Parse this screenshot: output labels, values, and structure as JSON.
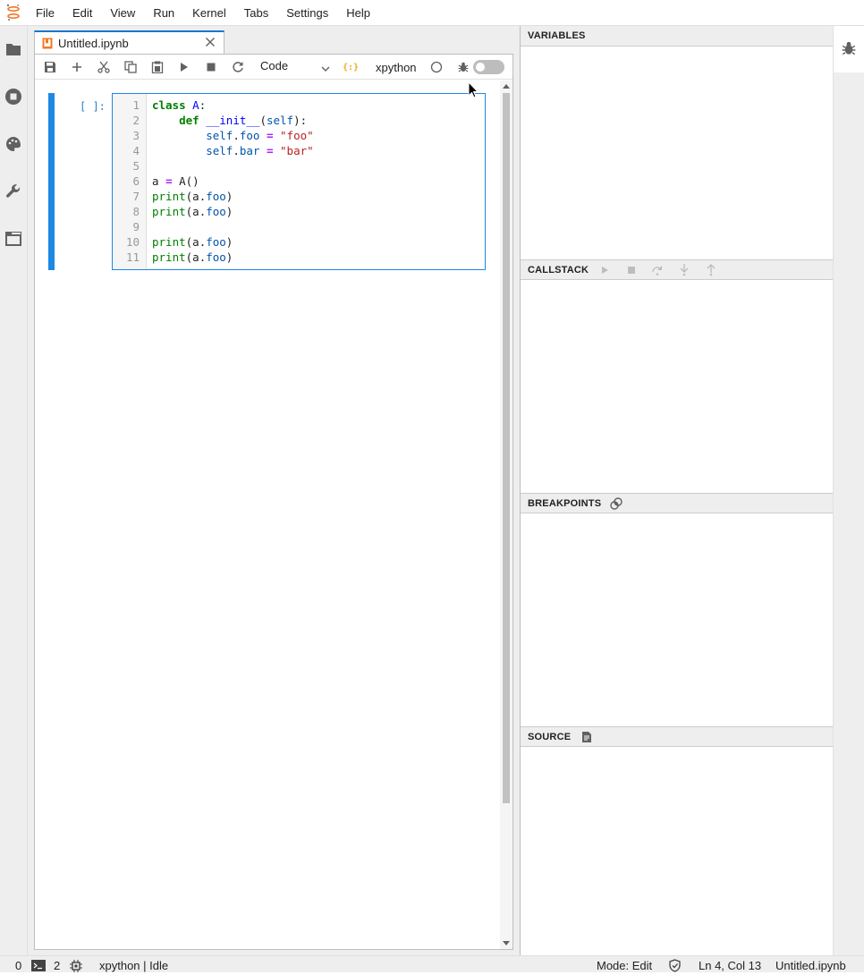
{
  "menubar": {
    "items": [
      "File",
      "Edit",
      "View",
      "Run",
      "Kernel",
      "Tabs",
      "Settings",
      "Help"
    ]
  },
  "left_sidebar": {
    "icons": [
      "folder-icon",
      "running-icon",
      "palette-icon",
      "wrench-icon",
      "tabs-icon"
    ]
  },
  "document_tab": {
    "label": "Untitled.ipynb",
    "icon": "notebook-icon"
  },
  "toolbar": {
    "cell_type": "Code",
    "kernel_name": "xpython",
    "kernel_status_icon": "circle-idle-icon",
    "debugger_toggle": "off"
  },
  "cell": {
    "prompt": "[ ]:",
    "line_numbers": [
      "1",
      "2",
      "3",
      "4",
      "5",
      "6",
      "7",
      "8",
      "9",
      "10",
      "11"
    ],
    "code_lines": [
      "class A:",
      "    def __init__(self):",
      "        self.foo = \"foo\"",
      "        self.bar = \"bar\"",
      "",
      "a = A()",
      "print(a.foo)",
      "print(a.foo)",
      "",
      "print(a.foo)",
      "print(a.foo)"
    ]
  },
  "debugger": {
    "variables_title": "VARIABLES",
    "callstack_title": "CALLSTACK",
    "breakpoints_title": "BREAKPOINTS",
    "source_title": "SOURCE"
  },
  "statusbar": {
    "count_a": "0",
    "count_b": "2",
    "kernel_status": "xpython | Idle",
    "mode": "Mode: Edit",
    "cursor": "Ln 4, Col 13",
    "file": "Untitled.ipynb"
  },
  "colors": {
    "accent": "#1e88e5",
    "jupyter_orange": "#f37726",
    "kernel_orange": "#f5a623"
  }
}
